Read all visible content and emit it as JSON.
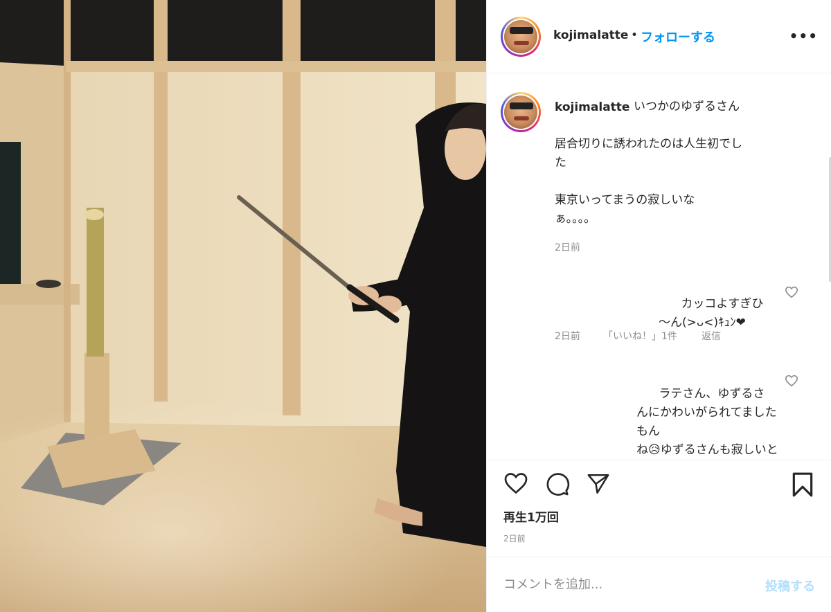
{
  "header": {
    "username": "kojimalatte",
    "dot": "•",
    "follow_label": "フォローする",
    "more_label": "•••"
  },
  "caption": {
    "username": "kojimalatte",
    "line1": "いつかのゆずるさん",
    "body": "居合切りに誘われたのは人生初でし\nた\n\n東京いってまうの寂しいな\nぁ。。。。",
    "time": "2日前"
  },
  "comments": [
    {
      "text": "カッコよすぎひ\n〜ん(>ᴗ<)ｷｭﾝ❤",
      "time": "2日前",
      "likes": "「いいね！」1件",
      "reply": "返信"
    },
    {
      "text": "ラテさん、ゆずるさ\nんにかわいがられてましたもん\nね😥ゆずるさんも寂しいと思い\nます。"
    }
  ],
  "stats": {
    "views": "再生1万回",
    "posted": "2日前"
  },
  "comment_box": {
    "placeholder": "コメントを追加...",
    "post_label": "投稿する"
  },
  "icons": {
    "like": "heart-icon",
    "comment": "comment-icon",
    "share": "paper-plane-icon",
    "save": "bookmark-icon"
  },
  "colors": {
    "accent": "#0095f6",
    "muted": "#8e8e8e",
    "post_disabled": "#b2dffc"
  }
}
